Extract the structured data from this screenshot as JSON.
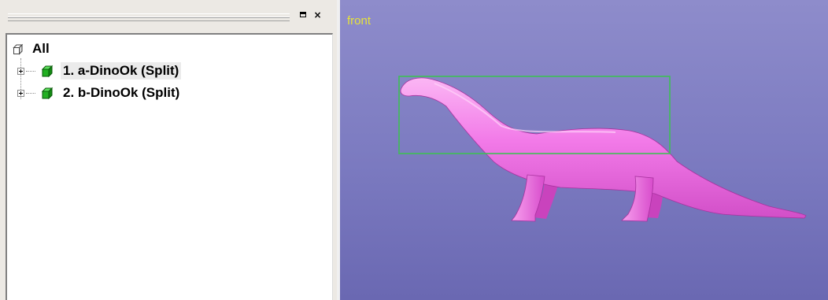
{
  "panel": {
    "restore_icon": "restore-icon",
    "close_glyph": "×"
  },
  "tree": {
    "root_label": "All",
    "items": [
      {
        "label": "1. a-DinoOk (Split)",
        "icon": "mesh-layer-icon",
        "icon_color": "#18a018"
      },
      {
        "label": "2. b-DinoOk (Split)",
        "icon": "mesh-layer-icon",
        "icon_color": "#18a018"
      }
    ]
  },
  "viewport": {
    "view_name": "front",
    "colors": {
      "model": "#f27ae8",
      "selection_box": "#3fbf55",
      "label": "#e6e23a"
    }
  }
}
